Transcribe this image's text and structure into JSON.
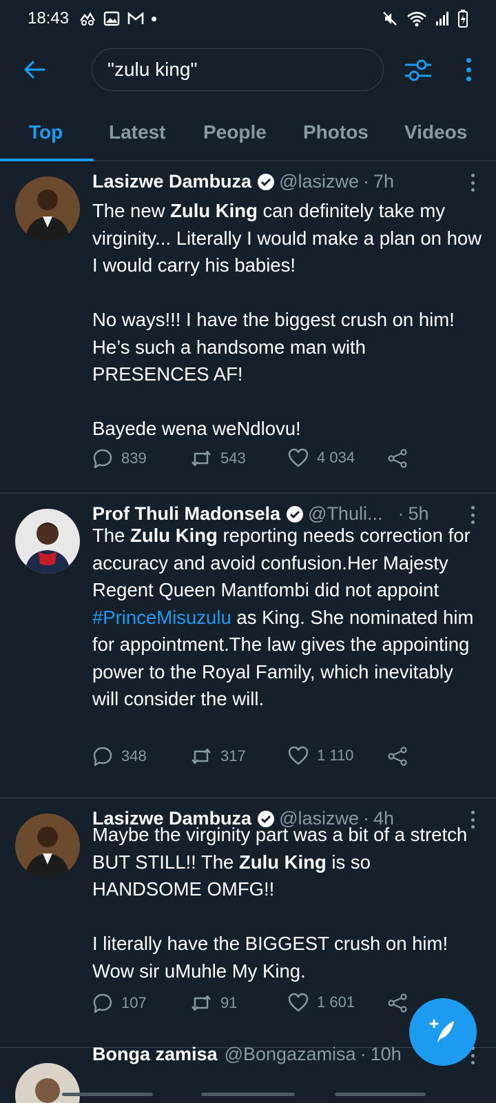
{
  "status_bar": {
    "time": "18:43"
  },
  "search": {
    "query": "\"zulu king\""
  },
  "tabs": [
    {
      "label": "Top"
    },
    {
      "label": "Latest"
    },
    {
      "label": "People"
    },
    {
      "label": "Photos"
    },
    {
      "label": "Videos"
    }
  ],
  "tweets": [
    {
      "name": "Lasizwe Dambuza",
      "handle": "@lasizwe",
      "separator": "·",
      "time": "7h",
      "body_html": "The new <b>Zulu King</b> can definitely take my virginity... Literally I would make a plan on how I would carry his babies!<br><br>No ways!!! I have the biggest crush on him! He’s such a handsome man with PRESENCES AF!<br><br>Bayede wena weNdlovu!",
      "replies": "839",
      "retweets": "543",
      "likes": "4 034"
    },
    {
      "name": "Prof Thuli Madonsela",
      "handle": "@Thuli...",
      "separator": "·",
      "time": "5h",
      "body_html": "The <b>Zulu King</b> reporting needs correction for accuracy and avoid confusion.Her Majesty Regent Queen Mantfombi did not appoint <span class=\"hashtag\">#PrinceMisuzulu</span> as King. She nominated him for appointment.The law gives the appointing power to the Royal Family, which inevitably will consider the will.",
      "replies": "348",
      "retweets": "317",
      "likes": "1 110"
    },
    {
      "name": "Lasizwe Dambuza",
      "handle": "@lasizwe",
      "separator": "·",
      "time": "4h",
      "body_html": "Maybe the virginity part was a bit of a stretch BUT STILL!! The <b>Zulu King</b> is so HANDSOME OMFG!!<br><br>I literally have the BIGGEST crush on him! Wow sir uMuhle My King.",
      "replies": "107",
      "retweets": "91",
      "likes": "1 601"
    },
    {
      "name": "Bonga zamisa",
      "handle": "@Bongazamisa",
      "separator": "·",
      "time": "10h"
    }
  ],
  "colors": {
    "background": "#15202b",
    "accent": "#1d9bf0",
    "secondary_text": "#8899a6",
    "divider": "#38444d"
  },
  "icons": [
    "back-arrow-icon",
    "filter-icon",
    "more-icon",
    "verified-icon",
    "reply-icon",
    "retweet-icon",
    "like-icon",
    "share-icon",
    "compose-icon"
  ]
}
